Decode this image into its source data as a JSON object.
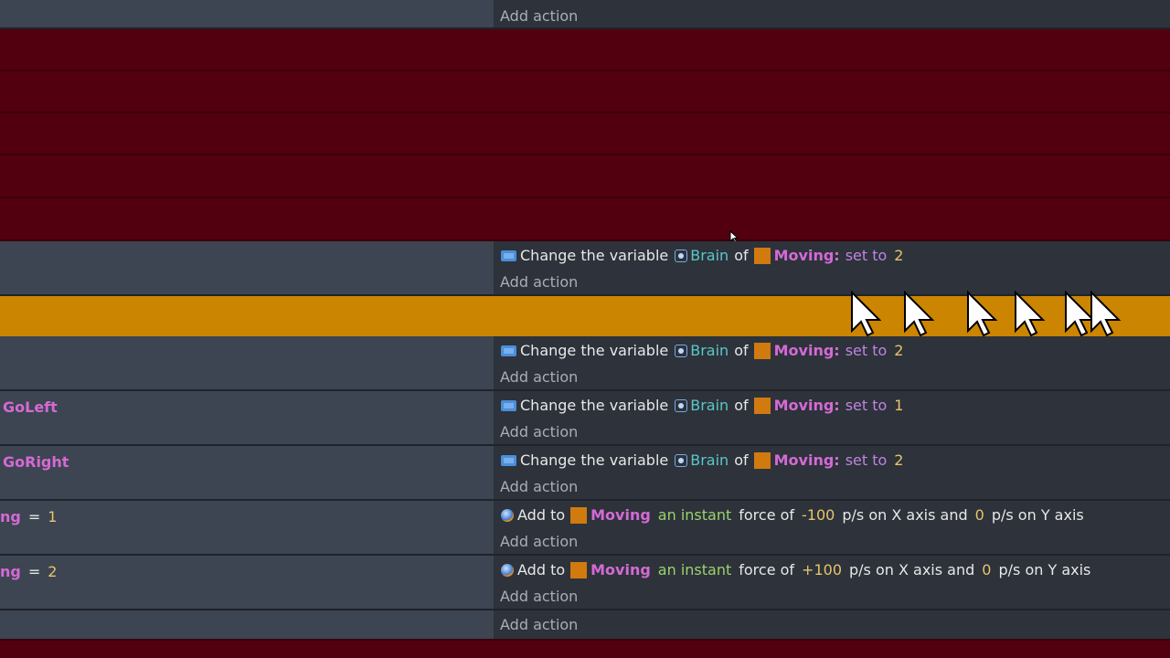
{
  "labels": {
    "add_action": "Add action",
    "change_var": "Change the variable",
    "var_name": "Brain",
    "of": "of",
    "object": "Moving",
    "set_to": "set to",
    "add_to": "Add to",
    "instant": "an instant",
    "force_of": "force of",
    "xaxis_unit": "p/s on X axis and",
    "yaxis_unit": "p/s on Y axis"
  },
  "events": [
    {
      "condition": "",
      "actions": []
    },
    {
      "condition": "",
      "actions": [
        {
          "type": "variable",
          "value": "2"
        }
      ]
    },
    {
      "condition": "",
      "actions": [
        {
          "type": "variable",
          "value": "2"
        }
      ]
    },
    {
      "condition": "GoLeft",
      "actions": [
        {
          "type": "variable",
          "value": "1"
        }
      ]
    },
    {
      "condition": "GoRight",
      "actions": [
        {
          "type": "variable",
          "value": "2"
        }
      ]
    },
    {
      "condition": "ng",
      "condition_op": "=",
      "condition_value": "1",
      "actions": [
        {
          "type": "force",
          "x": "-100",
          "y": "0"
        }
      ]
    },
    {
      "condition": "ng",
      "condition_op": "=",
      "condition_value": "2",
      "actions": [
        {
          "type": "force",
          "x": "+100",
          "y": "0"
        }
      ]
    },
    {
      "condition": "",
      "actions": []
    }
  ],
  "colors": {
    "disabled_row": "#520010",
    "selected_row": "#cc8500",
    "condition_bg": "#3d4452",
    "action_bg": "#2d323b",
    "object_color": "#d07a10"
  },
  "icons": [
    "variable-icon",
    "brain-variable-icon",
    "object-thumbnail-icon",
    "physics-force-icon",
    "mouse-cursor-icon"
  ]
}
